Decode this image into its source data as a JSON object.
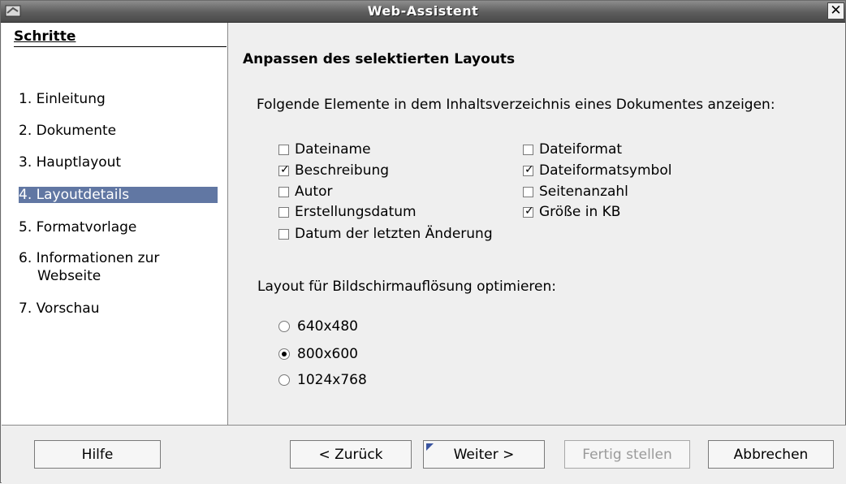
{
  "window": {
    "title": "Web-Assistent",
    "close_glyph": "✕"
  },
  "sidebar": {
    "title": "Schritte",
    "steps": [
      {
        "label": "1. Einleitung"
      },
      {
        "label": "2. Dokumente"
      },
      {
        "label": "3. Hauptlayout"
      },
      {
        "label": "4. Layoutdetails",
        "active": true
      },
      {
        "label": "5. Formatvorlage"
      },
      {
        "label": "6. Informationen zur"
      },
      {
        "label": "Webseite"
      },
      {
        "label": "7. Vorschau"
      }
    ]
  },
  "main": {
    "heading": "Anpassen des selektierten Layouts",
    "elements_label": "Folgende Elemente in dem Inhaltsverzeichnis eines Dokumentes anzeigen:",
    "checkboxes": [
      {
        "label": "Dateiname",
        "checked": false
      },
      {
        "label": "Beschreibung",
        "checked": true
      },
      {
        "label": "Autor",
        "checked": false
      },
      {
        "label": "Erstellungsdatum",
        "checked": false
      },
      {
        "label": "Datum der letzten Änderung",
        "checked": false
      },
      {
        "label": "Dateiformat",
        "checked": false
      },
      {
        "label": "Dateiformatsymbol",
        "checked": true
      },
      {
        "label": "Seitenanzahl",
        "checked": false
      },
      {
        "label": "Größe in KB",
        "checked": true
      }
    ],
    "resolution_label": "Layout für Bildschirmauflösung optimieren:",
    "resolutions": [
      {
        "label": "640x480",
        "selected": false
      },
      {
        "label": "800x600",
        "selected": true
      },
      {
        "label": "1024x768",
        "selected": false
      }
    ]
  },
  "buttons": {
    "help": "Hilfe",
    "back": "< Zurück",
    "next": "Weiter >",
    "finish": "Fertig stellen",
    "cancel": "Abbrechen"
  },
  "colors": {
    "selection": "#6177a3",
    "titlebar": "#5d5d5d"
  }
}
